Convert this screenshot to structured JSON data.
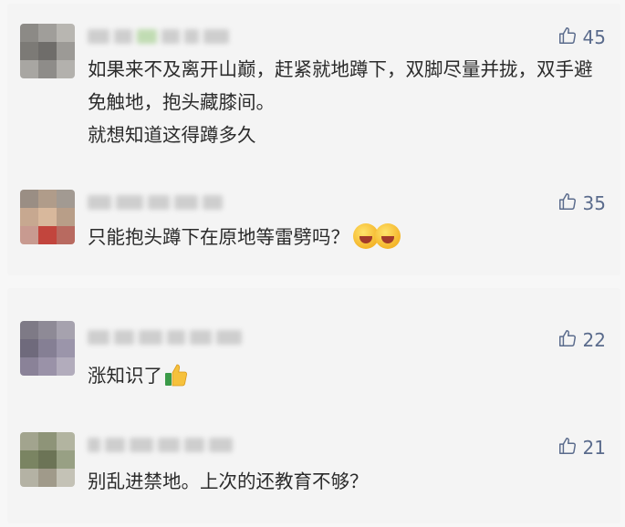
{
  "colors": {
    "like_blue": "#5a6b8c",
    "card_bg": "#f4f4f4",
    "text": "#2b2b2b"
  },
  "cards": [
    {
      "comments": [
        {
          "likes": "45",
          "text": "如果来不及离开山巅，赶紧就地蹲下，双脚尽量并拢，双手避免触地，抱头藏膝间。\n就想知道这得蹲多久"
        },
        {
          "likes": "35",
          "text": "只能抱头蹲下在原地等雷劈吗？",
          "emojis": [
            "laughing-tears-emoji",
            "laughing-tears-emoji"
          ]
        }
      ]
    },
    {
      "comments": [
        {
          "likes": "22",
          "text": "涨知识了",
          "emojis": [
            "thumbs-up-emoji"
          ]
        },
        {
          "likes": "21",
          "text": "别乱进禁地。上次的还教育不够？"
        }
      ]
    }
  ],
  "icons": {
    "like": "thumbs-up-outline-icon"
  }
}
